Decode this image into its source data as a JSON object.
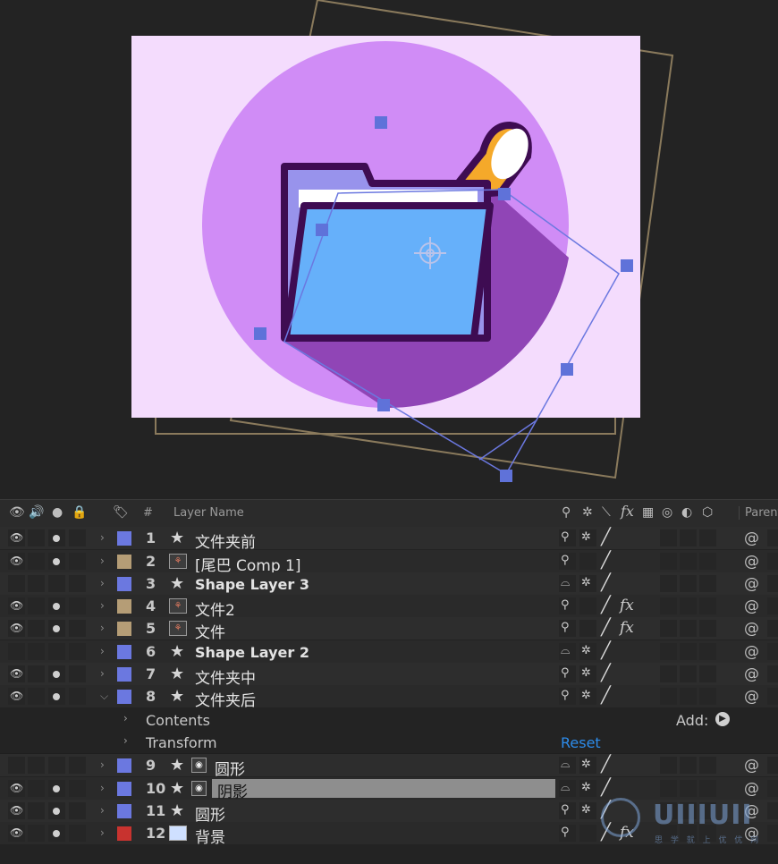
{
  "header": {
    "hash": "#",
    "layer_name": "Layer Name",
    "parent": "Parent",
    "fx": "fx"
  },
  "layers": [
    {
      "num": "1",
      "name": "文件夹前",
      "type": "shape",
      "label_color": "#6b78e0",
      "eye": true,
      "dot": true,
      "row_dark": false
    },
    {
      "num": "2",
      "name": "[尾巴 Comp 1]",
      "type": "comp",
      "label_color": "#b59d76",
      "eye": true,
      "dot": true
    },
    {
      "num": "3",
      "name": "Shape Layer 3",
      "type": "shape",
      "label_color": "#6b78e0",
      "eye": false,
      "dot": false,
      "bold": true
    },
    {
      "num": "4",
      "name": "文件2",
      "type": "comp",
      "label_color": "#b59d76",
      "eye": true,
      "dot": true,
      "fx": true
    },
    {
      "num": "5",
      "name": "文件",
      "type": "comp",
      "label_color": "#b59d76",
      "eye": true,
      "dot": true,
      "fx": true
    },
    {
      "num": "6",
      "name": "Shape Layer 2",
      "type": "shape",
      "label_color": "#6b78e0",
      "eye": false,
      "dot": false,
      "bold": true
    },
    {
      "num": "7",
      "name": "文件夹中",
      "type": "shape",
      "label_color": "#6b78e0",
      "eye": true,
      "dot": true
    },
    {
      "num": "8",
      "name": "文件夹后",
      "type": "shape",
      "label_color": "#6b78e0",
      "eye": true,
      "dot": true,
      "expanded": true
    },
    {
      "num": "9",
      "name": "圆形",
      "type": "mask",
      "label_color": "#6b78e0",
      "eye": false,
      "dot": false
    },
    {
      "num": "10",
      "name": "阴影",
      "type": "mask",
      "label_color": "#6b78e0",
      "eye": true,
      "dot": true,
      "selected": true
    },
    {
      "num": "11",
      "name": "圆形",
      "type": "shape",
      "label_color": "#6b78e0",
      "eye": true,
      "dot": true
    },
    {
      "num": "12",
      "name": "背景",
      "type": "solid",
      "label_color": "#c8332f",
      "eye": true,
      "dot": true,
      "fx": true
    }
  ],
  "sub_rows": {
    "contents": "Contents",
    "transform": "Transform",
    "add": "Add:",
    "reset": "Reset"
  },
  "watermark": {
    "text": "UIIIUII",
    "sub": "思 学 就 上 优 优 网"
  },
  "colors": {
    "bg_frame": "#f4dcfd",
    "circle": "#d08cf6",
    "shadow": "#9045b6",
    "folder_front": "#66b0fa",
    "folder_back": "#9893ec",
    "outline": "#3e0c52",
    "tail": "#f5a92a",
    "handle": "#5f72d9"
  }
}
